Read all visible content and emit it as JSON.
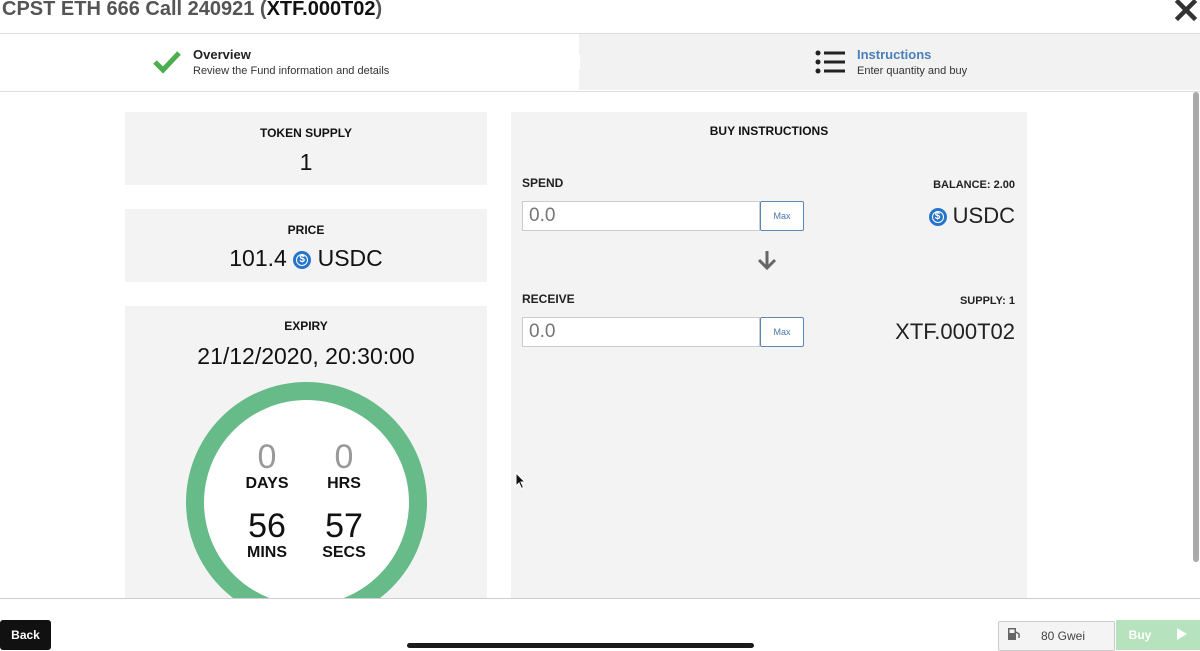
{
  "window": {
    "title_prefix": "CPST ETH 666 Call 240921 (",
    "title_code": "XTF.000T02",
    "title_suffix": ")",
    "close_icon": "close-icon"
  },
  "steps": [
    {
      "title": "Overview",
      "subtitle": "Review the Fund information and details",
      "icon": "checkmark-icon"
    },
    {
      "title": "Instructions",
      "subtitle": "Enter quantity and buy",
      "icon": "list-icon"
    }
  ],
  "token_supply": {
    "label": "TOKEN SUPPLY",
    "value": "1"
  },
  "price": {
    "label": "PRICE",
    "value": "101.4",
    "currency": "USDC"
  },
  "expiry": {
    "label": "EXPIRY",
    "date": "21/12/2020, 20:30:00",
    "days": "0",
    "days_label": "DAYS",
    "hrs": "0",
    "hrs_label": "HRS",
    "mins": "56",
    "mins_label": "MINS",
    "secs": "57",
    "secs_label": "SECS",
    "ring_color": "#66bb88"
  },
  "buy": {
    "heading": "BUY INSTRUCTIONS",
    "spend_label": "SPEND",
    "spend_placeholder": "0.0",
    "max_label": "Max",
    "balance_label": "BALANCE: 2.00",
    "spend_currency": "USDC",
    "receive_label": "RECEIVE",
    "receive_placeholder": "0.0",
    "supply_label": "SUPPLY: 1",
    "receive_token": "XTF.000T02"
  },
  "footer": {
    "back_label": "Back",
    "gas_value": "80 Gwei",
    "buy_label": "Buy"
  },
  "colors": {
    "check_green": "#4cae4f",
    "instructions_blue": "#4a7fb8",
    "buy_button": "#b6e2bd",
    "usdc_blue": "#2775ca"
  }
}
